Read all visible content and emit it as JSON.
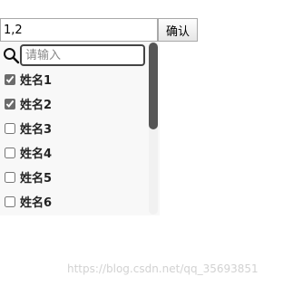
{
  "value_input": {
    "value": "1,2"
  },
  "confirm_button": {
    "label": "确认"
  },
  "search": {
    "placeholder": "请输入",
    "icon": "search-icon"
  },
  "options": [
    {
      "label": "姓名1",
      "checked": true
    },
    {
      "label": "姓名2",
      "checked": true
    },
    {
      "label": "姓名3",
      "checked": false
    },
    {
      "label": "姓名4",
      "checked": false
    },
    {
      "label": "姓名5",
      "checked": false
    },
    {
      "label": "姓名6",
      "checked": false
    }
  ],
  "scrollbar": {
    "scroll_position": 0,
    "visible_fraction": 0.5
  },
  "watermark": {
    "text": "https://blog.csdn.net/qq_35693851"
  },
  "colors": {
    "scrollbar_thumb": "#555555",
    "panel_background": "#f8f8f8",
    "search_border": "#444444"
  }
}
